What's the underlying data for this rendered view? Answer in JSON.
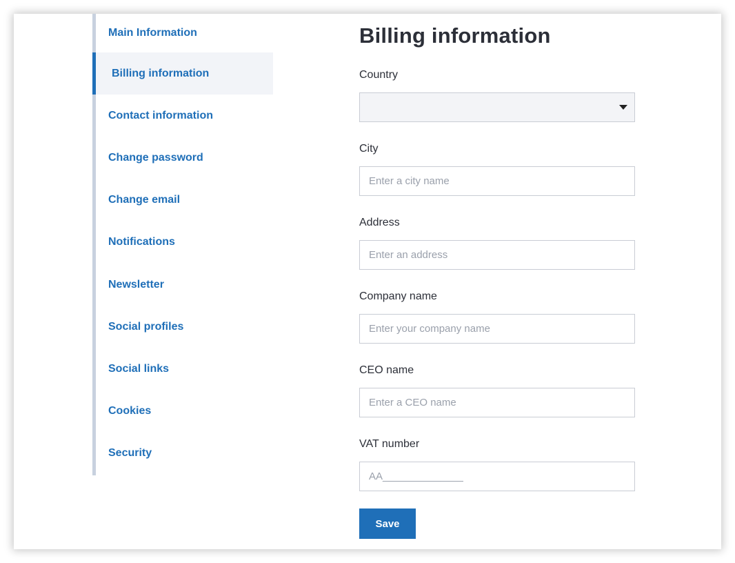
{
  "sidebar": {
    "items": [
      {
        "label": "Main Information"
      },
      {
        "label": "Billing information",
        "active": true
      },
      {
        "label": "Contact information"
      },
      {
        "label": "Change password"
      },
      {
        "label": "Change email"
      },
      {
        "label": "Notifications"
      },
      {
        "label": "Newsletter"
      },
      {
        "label": "Social profiles"
      },
      {
        "label": "Social links"
      },
      {
        "label": "Cookies"
      },
      {
        "label": "Security"
      }
    ]
  },
  "main": {
    "title": "Billing information",
    "country": {
      "label": "Country",
      "value": ""
    },
    "city": {
      "label": "City",
      "placeholder": "Enter a city name",
      "value": ""
    },
    "address": {
      "label": "Address",
      "placeholder": "Enter an address",
      "value": ""
    },
    "company": {
      "label": "Company name",
      "placeholder": "Enter your company name",
      "value": ""
    },
    "ceo": {
      "label": "CEO name",
      "placeholder": "Enter a CEO name",
      "value": ""
    },
    "vat": {
      "label": "VAT number",
      "placeholder": "AA______________",
      "value": ""
    },
    "save_label": "Save"
  },
  "colors": {
    "accent": "#1f6fb8",
    "active_bg": "#f2f4f8",
    "sidebar_rail": "#c8d1df",
    "text": "#2c2f38",
    "placeholder": "#9aa0ab"
  },
  "icons": {
    "country_select": "caret-down-icon"
  }
}
